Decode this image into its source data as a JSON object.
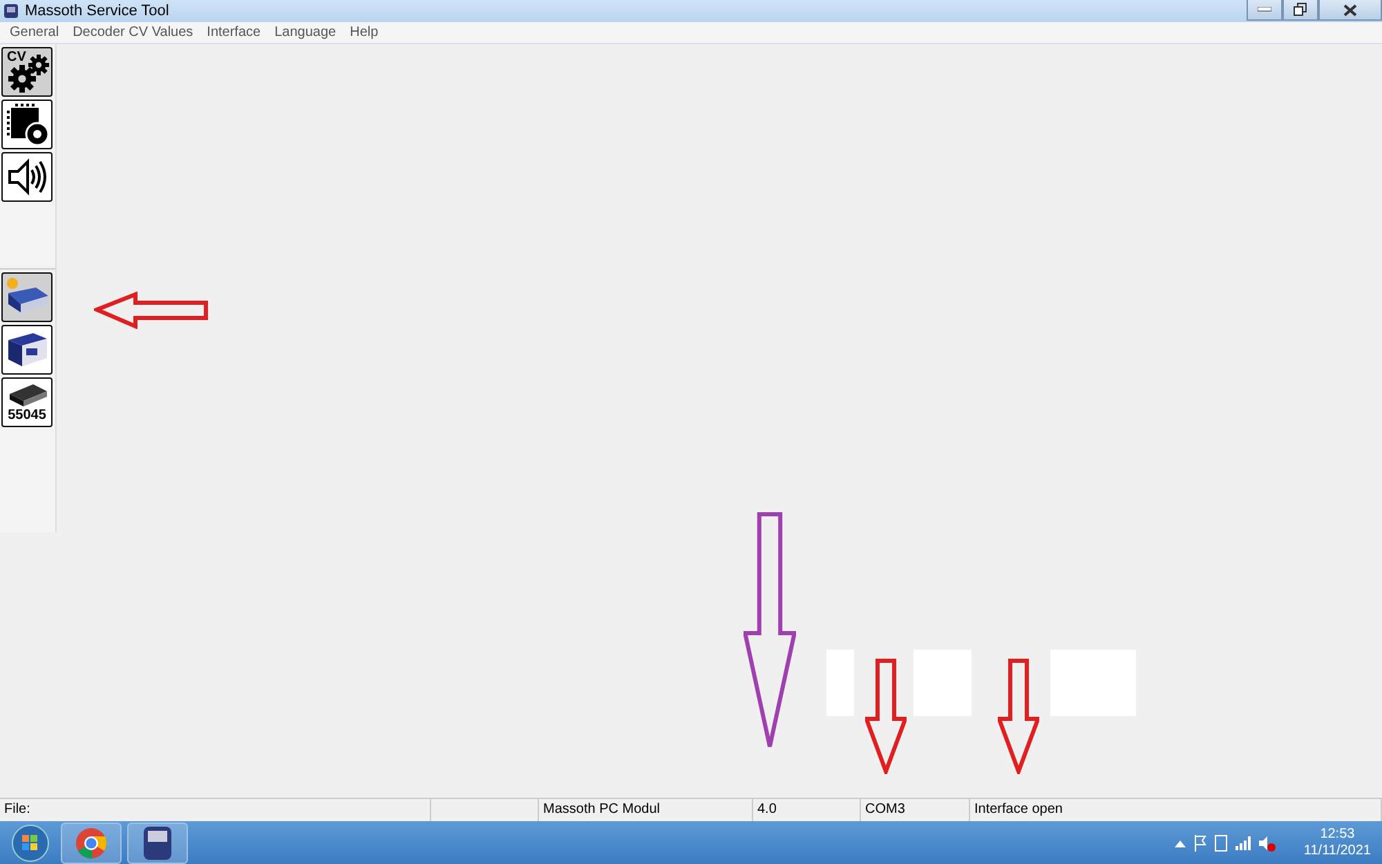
{
  "window": {
    "title": "Massoth Service Tool"
  },
  "menu": [
    "General",
    "Decoder CV Values",
    "Interface",
    "Language",
    "Help"
  ],
  "toolbar_top": [
    {
      "kind": "cv",
      "label": "CV",
      "selected": true
    },
    {
      "kind": "chip",
      "selected": false
    },
    {
      "kind": "speaker",
      "selected": false
    }
  ],
  "toolbar_bottom": [
    {
      "kind": "interface",
      "selected": true
    },
    {
      "kind": "central",
      "selected": false
    },
    {
      "kind": "module",
      "label": "55045",
      "selected": false
    }
  ],
  "annotations": [
    {
      "kind": "arrow-left",
      "color": "#e02020"
    },
    {
      "kind": "arrow-down",
      "color": "#a040b0"
    },
    {
      "kind": "arrow-down",
      "color": "#e02020"
    },
    {
      "kind": "arrow-down",
      "color": "#e02020"
    }
  ],
  "status_bar": {
    "file": "File:",
    "panes": [
      "Massoth PC Modul",
      "4.0",
      "COM3",
      "Interface open"
    ]
  },
  "taskbar": {
    "time": "12:53",
    "date": "11/11/2021"
  }
}
